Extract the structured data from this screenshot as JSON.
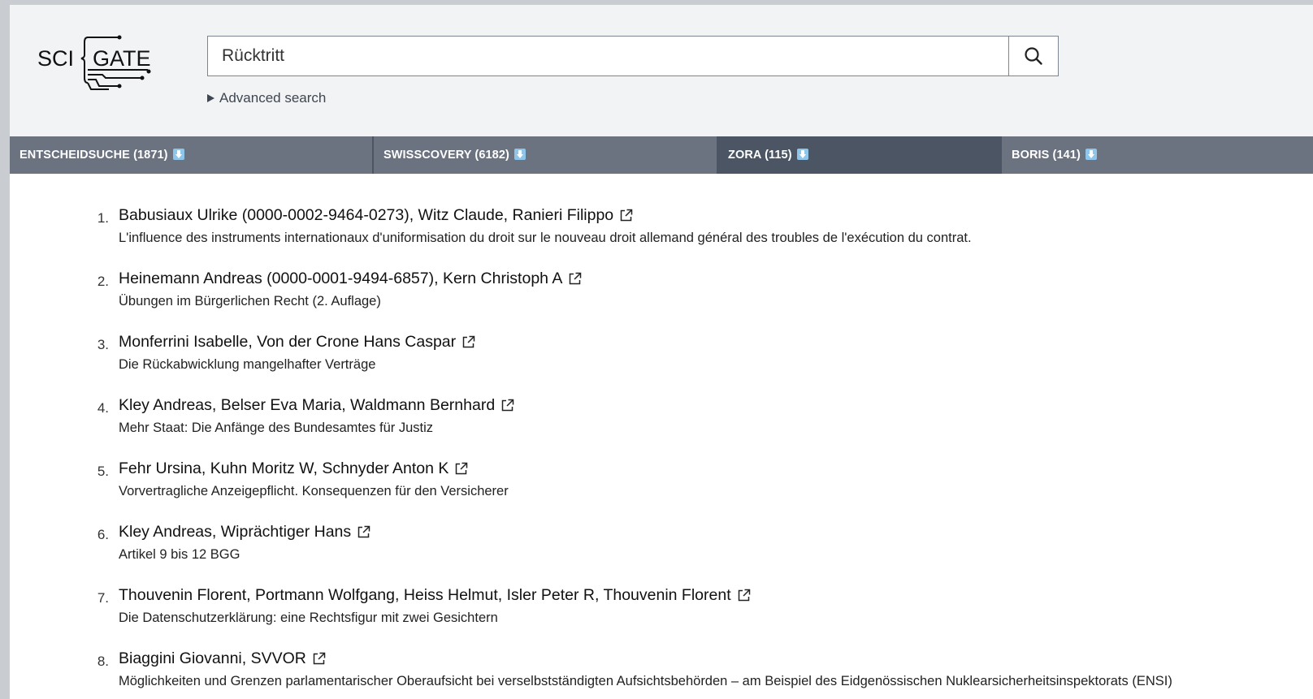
{
  "header": {
    "logo_text_left": "SCI",
    "logo_text_right": "GATE"
  },
  "search": {
    "value": "Rücktritt",
    "placeholder": "",
    "advanced_label": "Advanced search"
  },
  "tabs": [
    {
      "label": "ENTSCHEIDSUCHE (1871)"
    },
    {
      "label": "SWISSCOVERY (6182)"
    },
    {
      "label": "ZORA (115)"
    },
    {
      "label": "BORIS (141)"
    }
  ],
  "active_tab": "ZORA (115)",
  "results": [
    {
      "num": "1.",
      "authors": "Babusiaux Ulrike (0000-0002-9464-0273), Witz Claude, Ranieri Filippo",
      "title": "L'influence des instruments internationaux d'uniformisation du droit sur le nouveau droit allemand général des troubles de l'exécution du contrat."
    },
    {
      "num": "2.",
      "authors": "Heinemann Andreas (0000-0001-9494-6857), Kern Christoph A",
      "title": "Übungen im Bürgerlichen Recht (2. Auflage)"
    },
    {
      "num": "3.",
      "authors": "Monferrini Isabelle, Von der Crone Hans Caspar",
      "title": "Die Rückabwicklung mangelhafter Verträge"
    },
    {
      "num": "4.",
      "authors": "Kley Andreas, Belser Eva Maria, Waldmann Bernhard",
      "title": "Mehr Staat: Die Anfänge des Bundesamtes für Justiz"
    },
    {
      "num": "5.",
      "authors": "Fehr Ursina, Kuhn Moritz W, Schnyder Anton K",
      "title": "Vorvertragliche Anzeigepflicht. Konsequenzen für den Versicherer"
    },
    {
      "num": "6.",
      "authors": "Kley Andreas, Wiprächtiger Hans",
      "title": "Artikel 9 bis 12 BGG"
    },
    {
      "num": "7.",
      "authors": "Thouvenin Florent, Portmann Wolfgang, Heiss Helmut, Isler Peter R, Thouvenin Florent",
      "title": "Die Datenschutzerklärung: eine Rechtsfigur mit zwei Gesichtern"
    },
    {
      "num": "8.",
      "authors": "Biaggini Giovanni, SVVOR",
      "title": "Möglichkeiten und Grenzen parlamentarischer Oberaufsicht bei verselbstständigten Aufsichtsbehörden – am Beispiel des Eidgenössischen Nuklearsicherheitsinspektorats (ENSI)"
    }
  ],
  "icons": {
    "search": "search-icon",
    "external_link": "external-link-icon",
    "download": "download-icon",
    "disclosure": "triangle-right-icon"
  },
  "colors": {
    "tab_bg": "#6b7280",
    "tab_active_bg": "#4b5563",
    "header_bg": "#f2f3f5",
    "download_icon": "#8ec5ea"
  }
}
